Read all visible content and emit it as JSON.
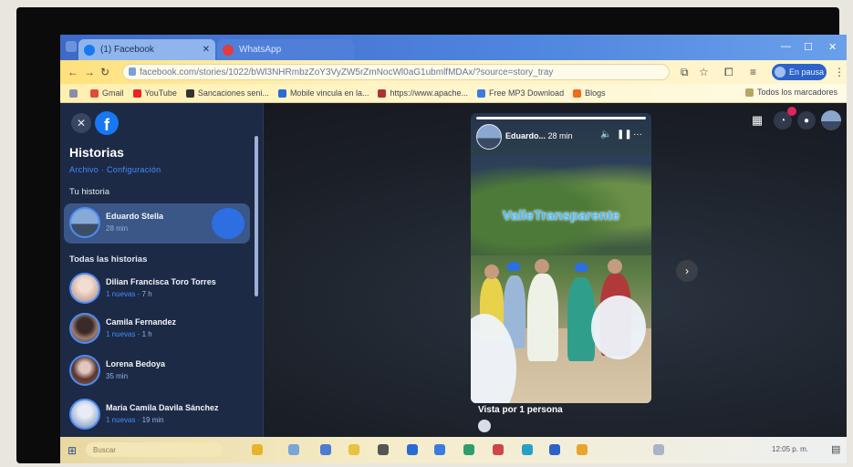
{
  "browser": {
    "tabs": [
      {
        "label": "(1) Facebook",
        "close": "✕"
      },
      {
        "label": "WhatsApp",
        "close": "✕"
      }
    ],
    "window_controls": {
      "minimize": "—",
      "maximize": "☐",
      "close": "✕"
    },
    "address": "facebook.com/stories/1022/bWl3NHRmbzZoY3VyZW5rZmNocWl0aG1ubmlfMDAx/?source=story_tray",
    "profile_label": "En pausa",
    "bookmarks": [
      "Gmail",
      "YouTube",
      "Sancaciones seni...",
      "Mobile vincula en la...",
      "https://www.apache...",
      "Free MP3 Download",
      "Blogs"
    ],
    "bookmarks_right": "Todos los marcadores"
  },
  "sidebar": {
    "title": "Historias",
    "links": "Archivo · Configuración",
    "your_story_label": "Tu historia",
    "my_story": {
      "name": "Eduardo Stella",
      "meta": "28 min"
    },
    "all_stories_label": "Todas las historias",
    "stories": [
      {
        "name": "Dilian Francisca Toro Torres",
        "new": "1 nuevas",
        "time": "7 h"
      },
      {
        "name": "Camila Fernandez",
        "new": "1 nuevas",
        "time": "1 h"
      },
      {
        "name": "Lorena Bedoya",
        "new": "",
        "time": "35 min"
      },
      {
        "name": "Maria Camila Davila Sánchez",
        "new": "1 nuevas",
        "time": "19 min"
      }
    ]
  },
  "story": {
    "author": "Eduardo...",
    "time": "28 min",
    "overlay_text": "ValleTransparente",
    "views": "Vista por 1 persona"
  },
  "taskbar": {
    "search_placeholder": "Buscar",
    "clock": "12:05 p. m."
  },
  "colors": {
    "facebook_blue": "#1877f2",
    "sidebar_bg": "#1d2a45",
    "selected_story_bg": "#3a5787",
    "link_blue": "#3f8cff"
  },
  "icons": [
    "facebook-logo-icon",
    "close-icon",
    "grid-menu-icon",
    "messenger-icon",
    "notifications-icon",
    "volume-icon",
    "pause-icon",
    "more-icon",
    "chevron-right-icon",
    "windows-start-icon"
  ]
}
